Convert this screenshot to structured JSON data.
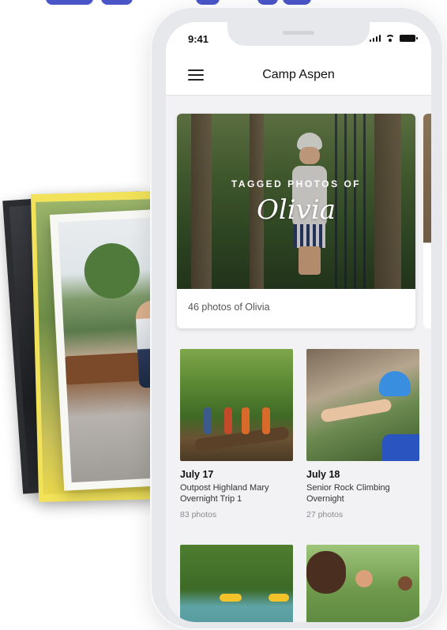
{
  "status_bar": {
    "time": "9:41"
  },
  "nav": {
    "title": "Camp Aspen",
    "menu_icon": "hamburger-icon"
  },
  "hero": {
    "label": "TAGGED PHOTOS OF",
    "name": "Olivia",
    "caption": "46 photos of Olivia"
  },
  "albums": [
    {
      "date": "July 17",
      "title": "Outpost Highland Mary Overnight Trip 1",
      "count": "83 photos"
    },
    {
      "date": "July 18",
      "title": "Senior Rock Climbing Overnight",
      "count": "27 photos"
    }
  ],
  "colors": {
    "accent": "#4a55c8",
    "background": "#f2f2f4",
    "phone_frame": "#e6e8ec"
  }
}
